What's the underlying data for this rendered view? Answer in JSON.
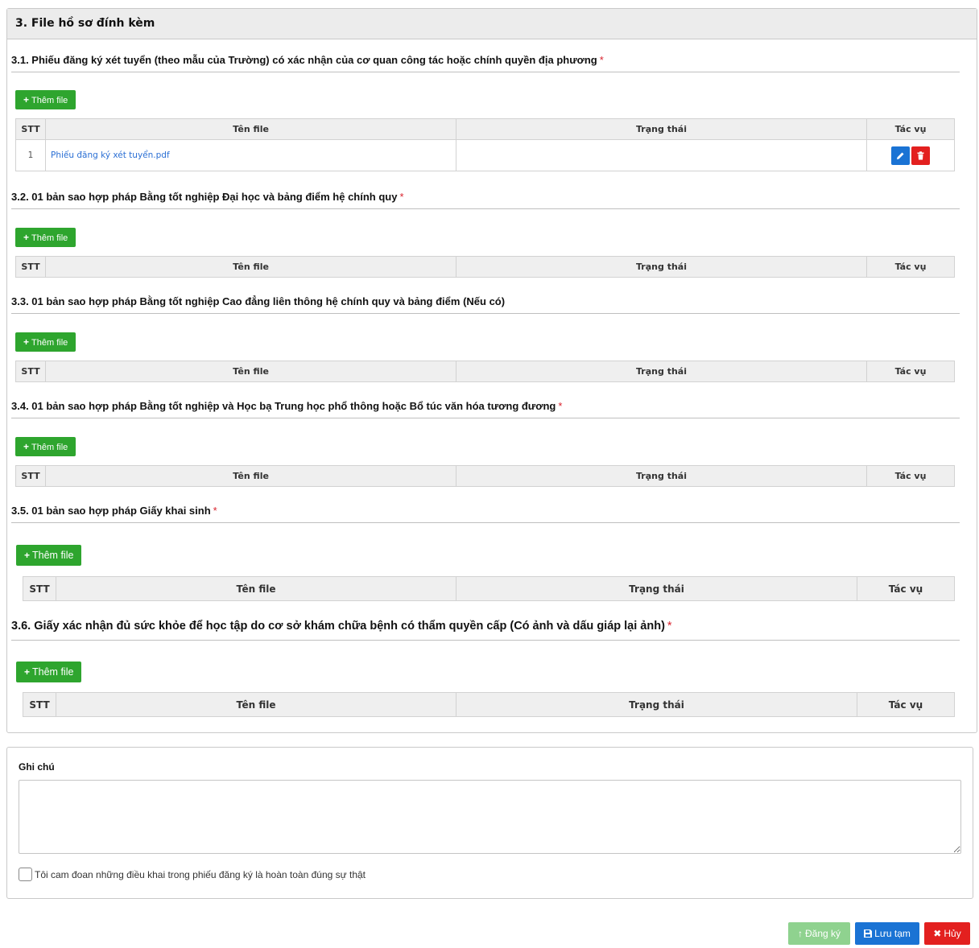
{
  "section": {
    "title": "3. File hồ sơ đính kèm"
  },
  "common": {
    "add_file": "Thêm file",
    "col_stt": "STT",
    "col_name": "Tên file",
    "col_status": "Trạng thái",
    "col_action": "Tác vụ",
    "required_mark": "*"
  },
  "subsections": [
    {
      "title": "3.1. Phiếu đăng ký xét tuyển (theo mẫu của Trường) có xác nhận của cơ quan công tác hoặc chính quyền địa phương",
      "required": true,
      "rows": [
        {
          "stt": "1",
          "name": "Phiếu đăng ký xét tuyển.pdf",
          "status": ""
        }
      ]
    },
    {
      "title": "3.2. 01 bản sao hợp pháp Bằng tốt nghiệp Đại học và bảng điểm hệ chính quy",
      "required": true,
      "rows": []
    },
    {
      "title": "3.3. 01 bản sao hợp pháp Bằng tốt nghiệp Cao đẳng liên thông hệ chính quy và bảng điểm (Nếu có)",
      "required": false,
      "rows": []
    },
    {
      "title": "3.4. 01 bản sao hợp pháp Bằng tốt nghiệp và Học bạ Trung học phổ thông hoặc Bổ túc văn hóa tương đương",
      "required": true,
      "rows": []
    },
    {
      "title": "3.5. 01 bản sao hợp pháp Giấy khai sinh",
      "required": true,
      "rows": []
    },
    {
      "title": "3.6. Giấy xác nhận đủ sức khỏe để học tập do cơ sở khám chữa bệnh có thẩm quyền cấp (Có ảnh và dấu giáp lại ảnh)",
      "required": true,
      "rows": []
    }
  ],
  "note": {
    "label": "Ghi chú",
    "value": ""
  },
  "agreement": {
    "text": "Tôi cam đoan những điều khai trong phiếu đăng ký là hoàn toàn đúng sự thật",
    "checked": false
  },
  "footer": {
    "register": "Đăng ký",
    "save_draft": "Lưu tạm",
    "cancel": "Hủy"
  },
  "colors": {
    "add_button": "#2ea52e",
    "edit_button": "#1a73d4",
    "delete_button": "#e3201f",
    "register_button": "#8fd28f",
    "required": "#d9232e"
  }
}
